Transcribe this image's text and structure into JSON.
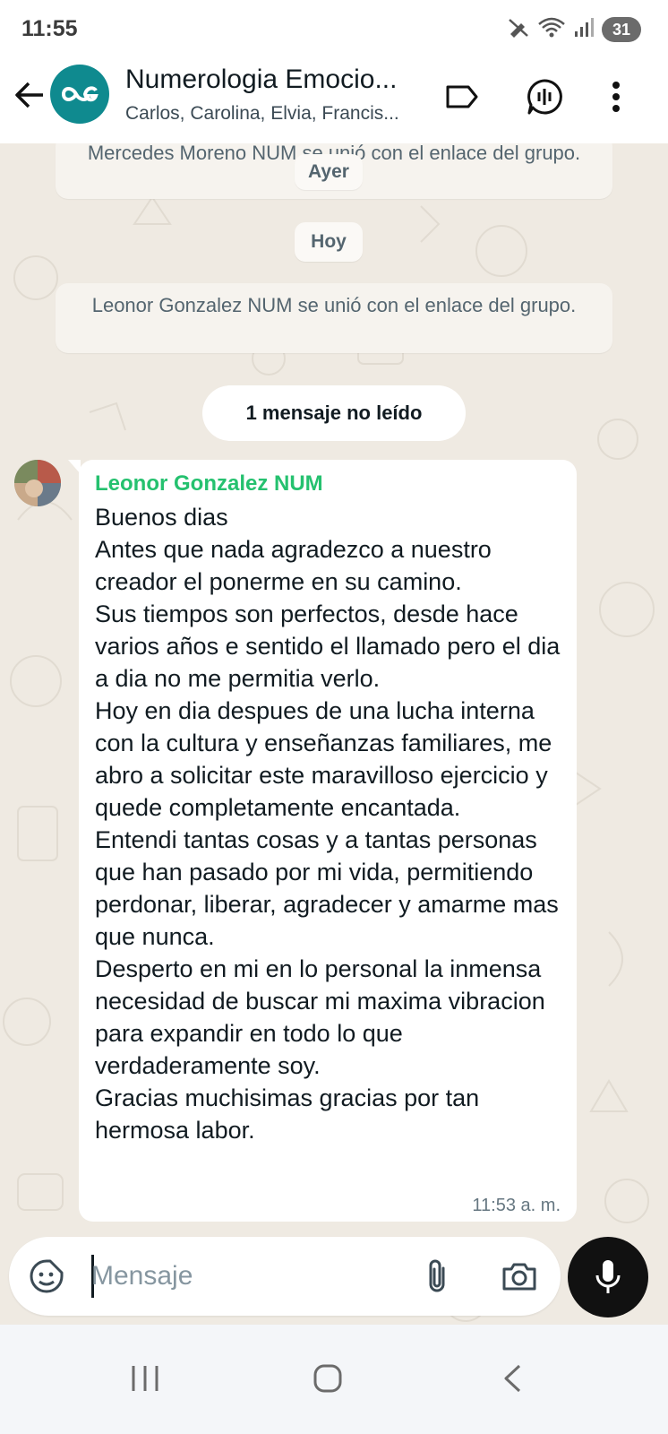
{
  "status_bar": {
    "time": "11:55",
    "battery": "31",
    "icons": [
      "no-disturb-icon",
      "wifi-icon",
      "signal-icon",
      "battery-icon"
    ]
  },
  "header": {
    "title": "Numerologia Emocio...",
    "subtitle": "Carlos, Carolina, Elvia, Francis...",
    "icons": [
      "back-arrow-icon",
      "label-icon",
      "voice-chat-icon",
      "more-vert-icon"
    ]
  },
  "chat": {
    "system_1": "Mercedes Moreno NUM se unió con el enlace del grupo.",
    "date_ayer": "Ayer",
    "date_hoy": "Hoy",
    "system_2": "Leonor Gonzalez NUM se unió con el enlace del grupo.",
    "unread": "1 mensaje no leído",
    "message": {
      "sender": "Leonor Gonzalez NUM",
      "text": "Buenos dias\nAntes que nada agradezco a nuestro creador el ponerme en su camino.\nSus tiempos son perfectos,  desde hace varios años e sentido el llamado pero el dia a dia no me permitia verlo.\nHoy en dia despues de una lucha interna con la cultura y enseñanzas familiares, me abro a solicitar este maravilloso ejercicio y quede completamente encantada.\nEntendi tantas cosas y a tantas personas que han pasado por mi vida, permitiendo perdonar, liberar, agradecer y amarme mas que nunca.\nDesperto en mi en lo personal la inmensa necesidad de buscar mi maxima vibracion para expandir en todo lo que verdaderamente soy.\nGracias muchisimas gracias por tan hermosa labor.",
      "time": "11:53 a. m."
    }
  },
  "composer": {
    "placeholder": "Mensaje",
    "icons": [
      "sticker-icon",
      "attach-icon",
      "camera-icon",
      "mic-icon"
    ]
  },
  "colors": {
    "sender_name": "#25c16f",
    "chat_background": "#efeae2",
    "group_avatar": "#0f8a8f"
  }
}
